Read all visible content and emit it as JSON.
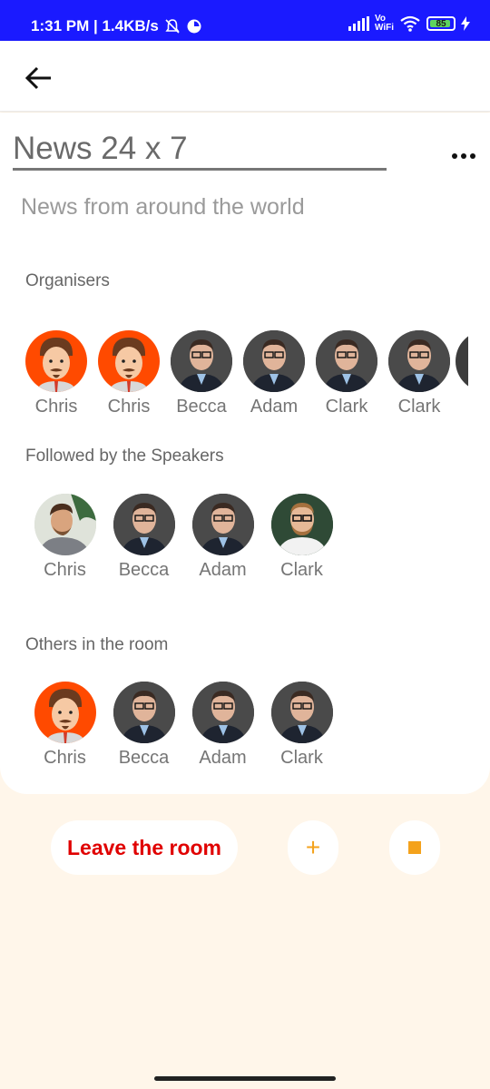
{
  "status_bar": {
    "time": "1:31 PM | 1.4KB/s",
    "vowifi_top": "Vo",
    "vowifi_bottom": "WiFi",
    "battery": "85"
  },
  "room": {
    "title": "News 24 x 7",
    "description": "News from around the world"
  },
  "organisers": {
    "label": "Organisers",
    "members": [
      {
        "name": "Chris",
        "avatar": "cartoon"
      },
      {
        "name": "Chris",
        "avatar": "cartoon"
      },
      {
        "name": "Becca",
        "avatar": "photo"
      },
      {
        "name": "Adam",
        "avatar": "photo"
      },
      {
        "name": "Clark",
        "avatar": "photo"
      },
      {
        "name": "Clark",
        "avatar": "photo"
      }
    ]
  },
  "speakers": {
    "label": "Followed by the Speakers",
    "members": [
      {
        "name": "Chris",
        "avatar": "photo-alt"
      },
      {
        "name": "Becca",
        "avatar": "photo"
      },
      {
        "name": "Adam",
        "avatar": "photo"
      },
      {
        "name": "Clark",
        "avatar": "photo-beard"
      }
    ]
  },
  "others": {
    "label": "Others in the room",
    "members": [
      {
        "name": "Chris",
        "avatar": "cartoon"
      },
      {
        "name": "Becca",
        "avatar": "photo"
      },
      {
        "name": "Adam",
        "avatar": "photo"
      },
      {
        "name": "Clark",
        "avatar": "photo"
      }
    ]
  },
  "actions": {
    "leave_label": "Leave the room",
    "plus_label": "+",
    "plus_icon": "plus-icon",
    "stop_icon": "stop-icon"
  },
  "colors": {
    "accent": "#f4a21c",
    "leave_text": "#e00000",
    "status_bar": "#1a1aff",
    "background": "#fff6ea"
  }
}
